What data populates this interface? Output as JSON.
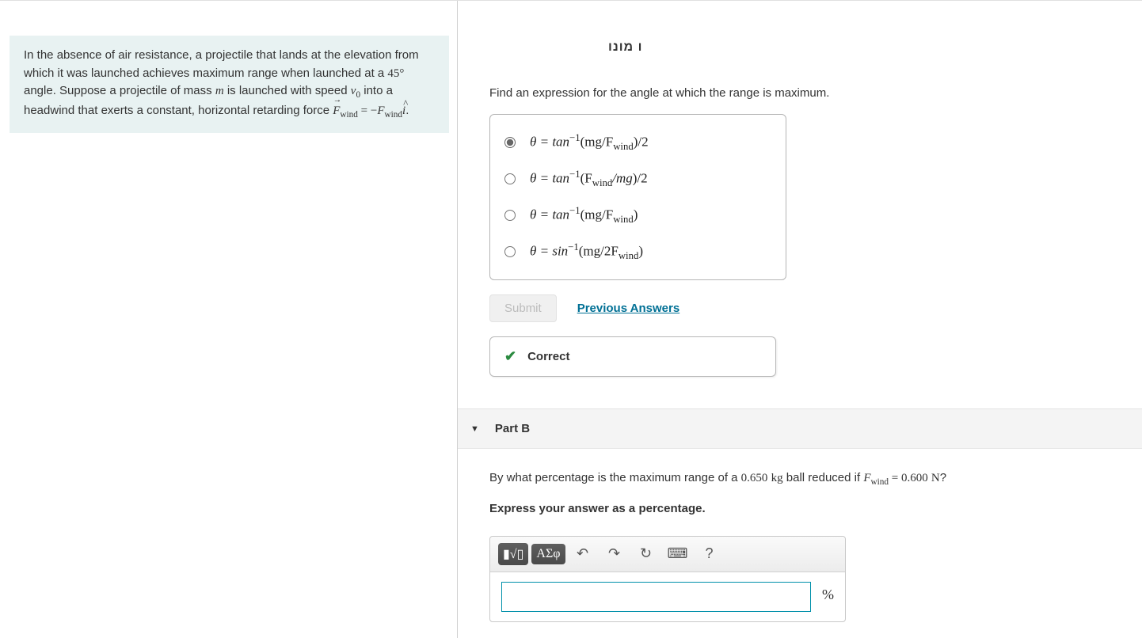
{
  "problem": {
    "text_1": "In the absence of air resistance, a projectile that lands at the elevation from which it was launched achieves maximum range when launched at a ",
    "angle": "45°",
    "text_2": " angle. Suppose a projectile of mass ",
    "mass_var": "m",
    "text_3": " is launched with speed ",
    "speed_var": "v",
    "speed_sub": "0",
    "text_4": " into a headwind that exerts a constant, horizontal retarding force ",
    "force_lhs_1": "F",
    "force_lhs_sub": "wind",
    "equals": " = ",
    "minus": "−",
    "force_rhs_1": "F",
    "force_rhs_sub": "wind",
    "ihat": "i",
    "period": "."
  },
  "partA": {
    "header_trunc": "ו מונו",
    "question": "Find an expression for the angle at which the range is maximum.",
    "choices": [
      {
        "prefix": "θ = tan",
        "sup": "−1",
        "arg": "(mg/F",
        "argsub": "wind",
        "tail": ")/2"
      },
      {
        "prefix": "θ = tan",
        "sup": "−1",
        "arg": "(F",
        "argsub": "wind",
        "argtail": "/mg",
        "tail": ")/2"
      },
      {
        "prefix": "θ = tan",
        "sup": "−1",
        "arg": "(mg/F",
        "argsub": "wind",
        "tail": ")"
      },
      {
        "prefix": "θ = sin",
        "sup": "−1",
        "arg": "(mg/2F",
        "argsub": "wind",
        "tail": ")"
      }
    ],
    "selected": 0,
    "submit_label": "Submit",
    "prev_label": "Previous Answers",
    "feedback": "Correct"
  },
  "partB": {
    "title": "Part B",
    "q_1": "By what percentage is the maximum range of a ",
    "mass_val": "0.650",
    "mass_unit": "kg",
    "q_2": " ball reduced if ",
    "f_var": "F",
    "f_sub": "wind",
    "eq": " = ",
    "f_val": "0.600",
    "f_unit": "N",
    "q_end": "?",
    "instruction": "Express your answer as a percentage.",
    "toolbar": {
      "templates": "▮√▯",
      "greek": "ΑΣφ",
      "undo": "↶",
      "redo": "↷",
      "reset": "↻",
      "keyboard": "⌨",
      "help": "?"
    },
    "unit": "%"
  }
}
